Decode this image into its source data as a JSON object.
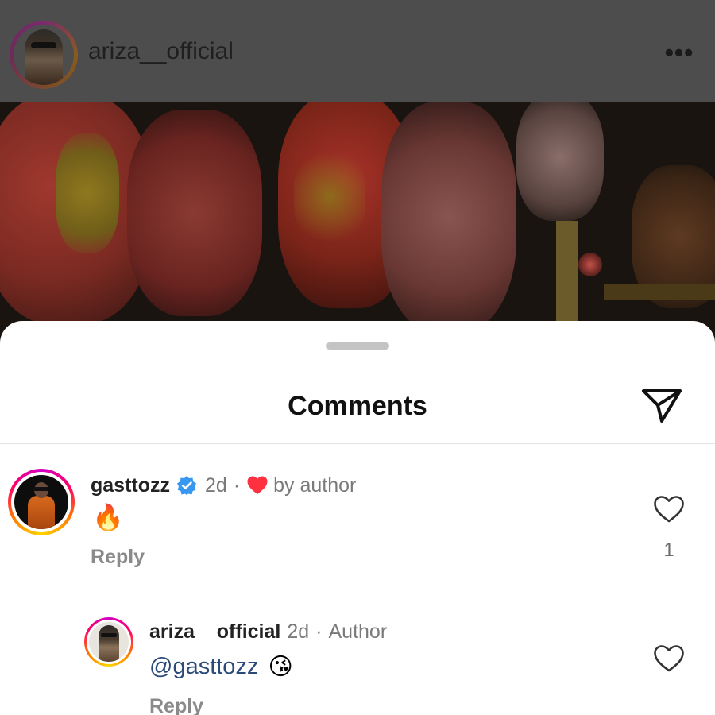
{
  "post": {
    "username": "ariza__official",
    "more_icon": "more-horizontal-icon"
  },
  "comments_sheet": {
    "title": "Comments",
    "share_icon": "paper-plane-icon",
    "comments": [
      {
        "username": "gasttozz",
        "verified": true,
        "time": "2d",
        "separator": "·",
        "liked_by_author_label": "by author",
        "text_emoji": "🔥",
        "reply_label": "Reply",
        "like_count": "1"
      }
    ],
    "replies": [
      {
        "username": "ariza__official",
        "time": "2d",
        "separator": "·",
        "badge": "Author",
        "mention": "@gasttozz",
        "text_emoji": "😘",
        "reply_label": "Reply"
      }
    ]
  },
  "colors": {
    "heart_red": "#ff3040",
    "verified_blue": "#3897f0",
    "mention_blue": "#2b4a7a"
  }
}
